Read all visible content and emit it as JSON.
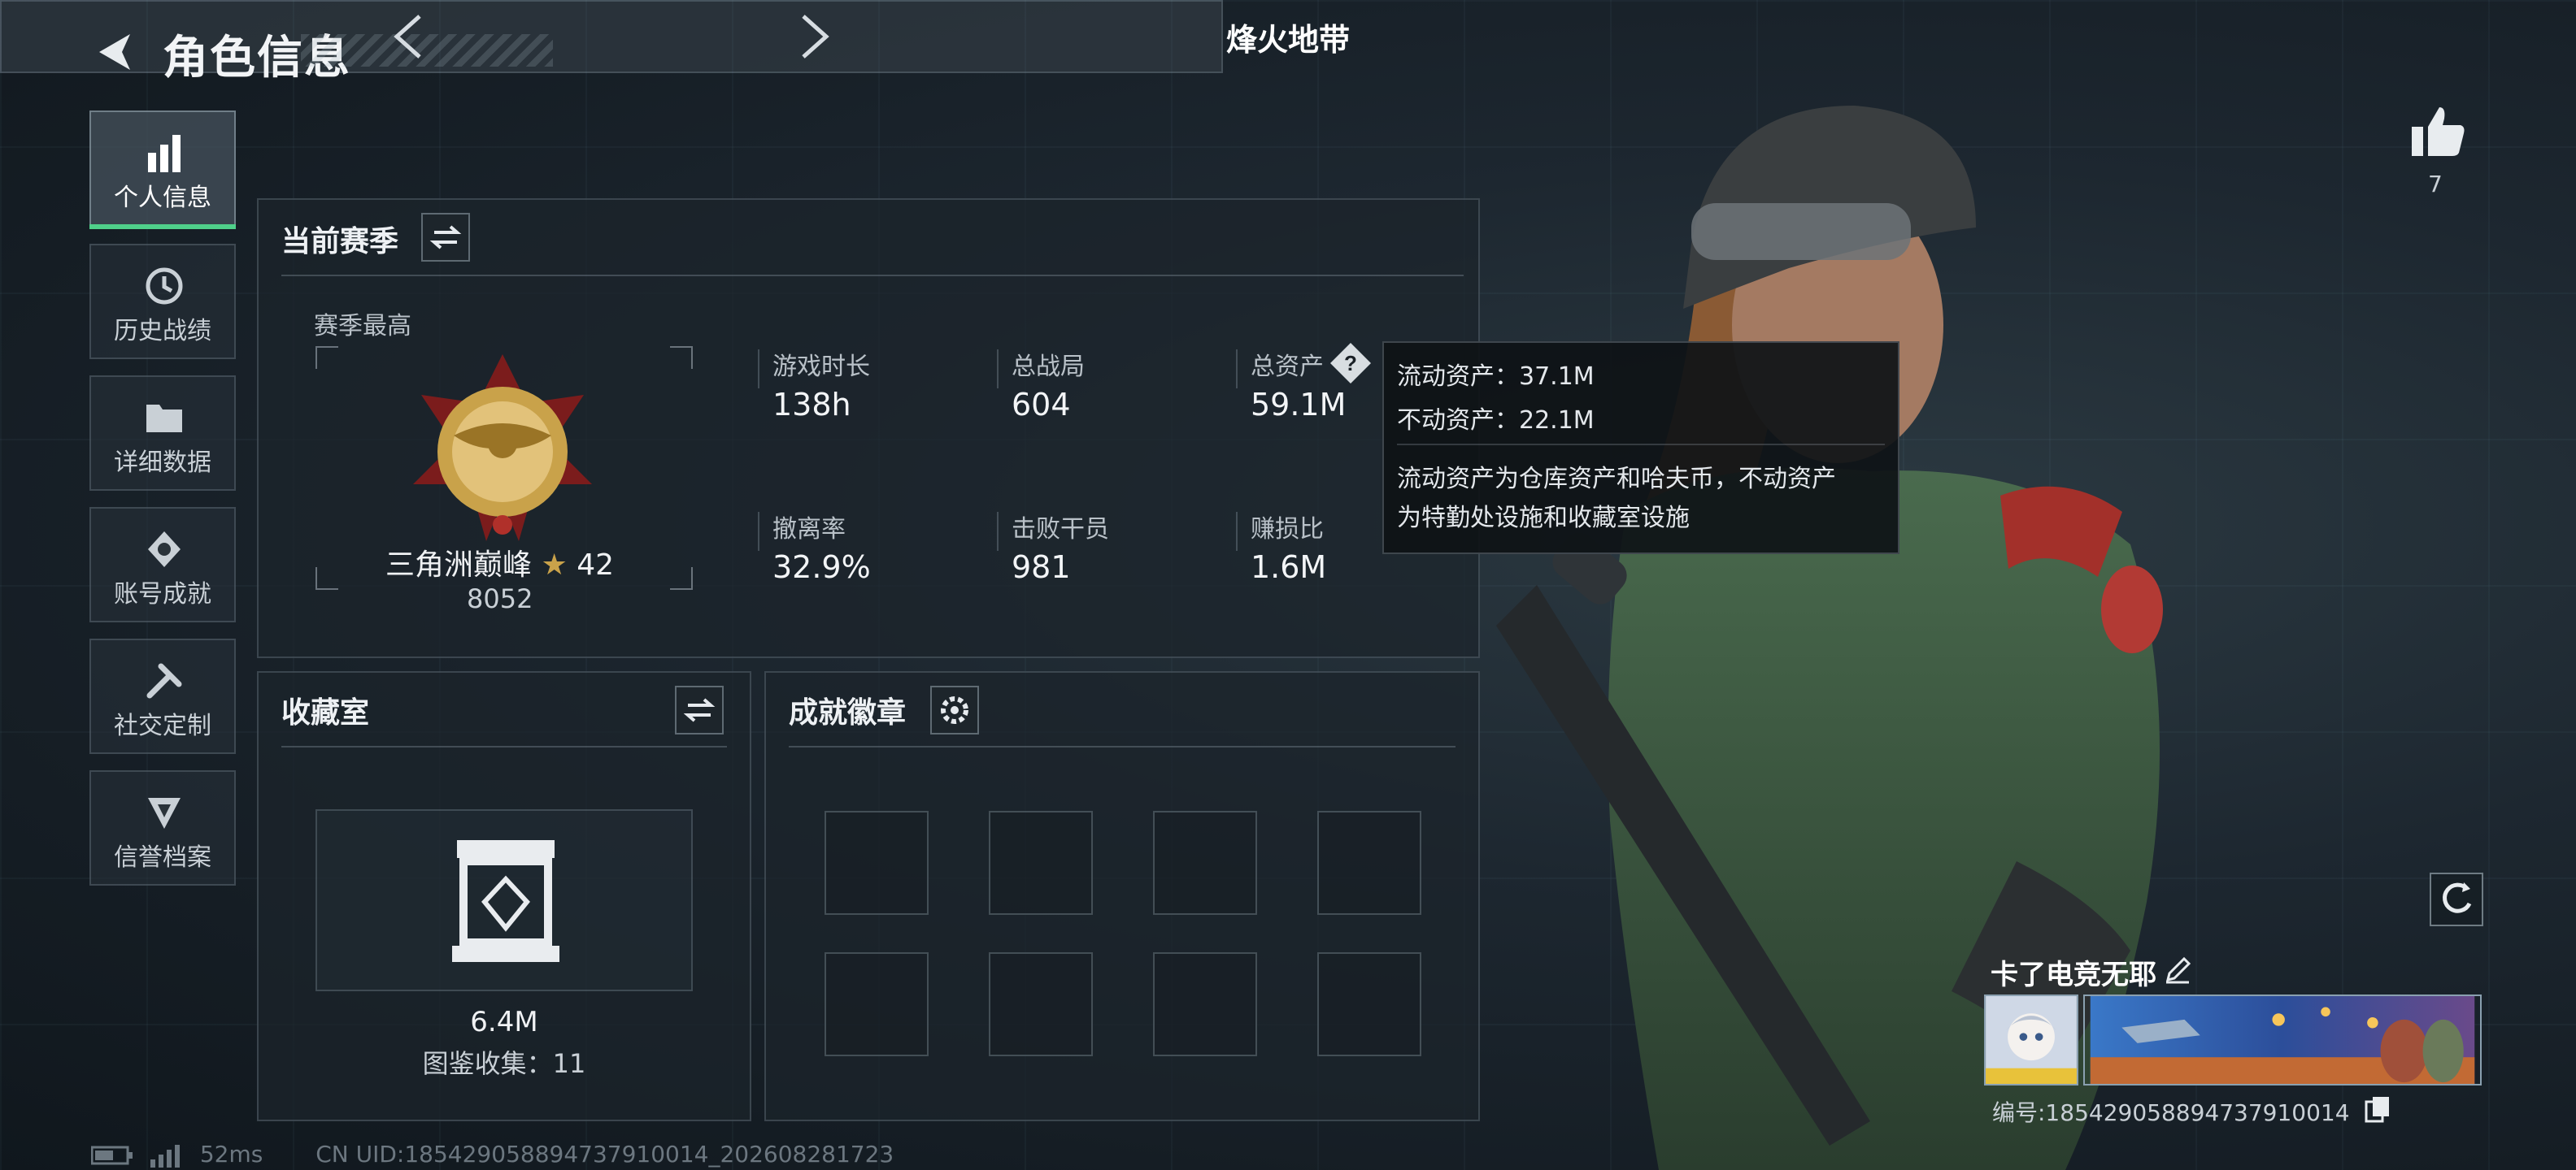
{
  "header": {
    "title": "角色信息"
  },
  "sidebar": {
    "items": [
      {
        "label": "个人信息",
        "icon": "bar-chart-icon",
        "active": true
      },
      {
        "label": "历史战绩",
        "icon": "history-icon",
        "active": false
      },
      {
        "label": "详细数据",
        "icon": "folder-icon",
        "active": false
      },
      {
        "label": "账号成就",
        "icon": "achievement-icon",
        "active": false
      },
      {
        "label": "社交定制",
        "icon": "tools-icon",
        "active": false
      },
      {
        "label": "信誉档案",
        "icon": "credit-icon",
        "active": false
      }
    ]
  },
  "mode_selector": {
    "label": "烽火地带"
  },
  "season": {
    "title": "当前赛季",
    "best_label": "赛季最高",
    "rank_name": "三角洲巅峰",
    "rank_stars": "42",
    "rank_score": "8052",
    "stats": [
      {
        "label": "游戏时长",
        "value": "138h"
      },
      {
        "label": "总战局",
        "value": "604"
      },
      {
        "label": "总资产",
        "value": "59.1M"
      },
      {
        "label": "撤离率",
        "value": "32.9%"
      },
      {
        "label": "击败干员",
        "value": "981"
      },
      {
        "label": "赚损比",
        "value": "1.6M"
      }
    ]
  },
  "tooltip": {
    "liquid": "流动资产：37.1M",
    "fixed": "不动资产：22.1M",
    "desc_line1": "流动资产为仓库资产和哈夫币，不动资产",
    "desc_line2": "为特勤处设施和收藏室设施"
  },
  "collection": {
    "title": "收藏室",
    "value": "6.4M",
    "count_text": "图鉴收集：11"
  },
  "badges": {
    "title": "成就徽章",
    "slots": 8
  },
  "profile": {
    "likes": "7",
    "name": "卡了电竞无耶",
    "id_text": "编号:1854290588947379100​14"
  },
  "footer": {
    "ping": "52ms",
    "uid": "CN UID:1854290588947379100​14_202608281723"
  },
  "colors": {
    "accent_green": "#4fd08a",
    "gold": "#c9a24a"
  }
}
